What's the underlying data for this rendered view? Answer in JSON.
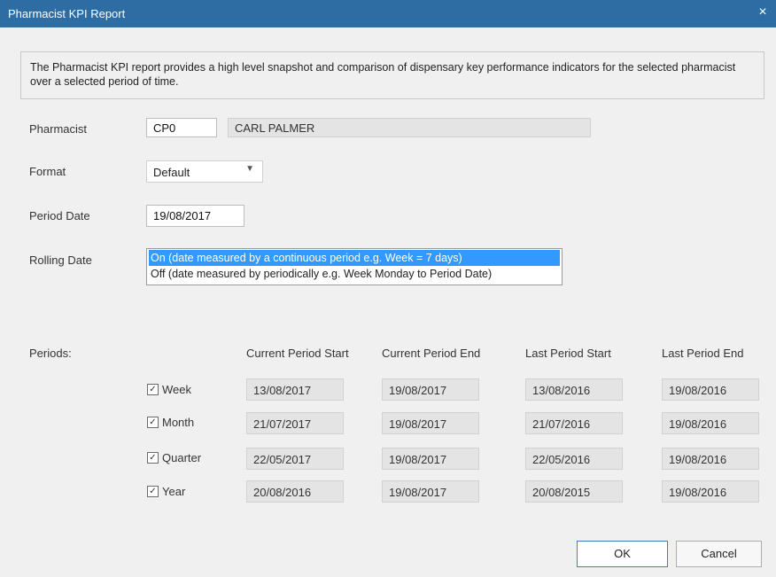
{
  "window": {
    "title": "Pharmacist KPI Report",
    "close_glyph": "×"
  },
  "description": "The Pharmacist KPI report provides a high level snapshot and comparison of dispensary key performance indicators for the selected pharmacist over a selected period of time.",
  "pharmacist": {
    "label": "Pharmacist",
    "code": "CP0",
    "name": "CARL PALMER"
  },
  "format": {
    "label": "Format",
    "value": "Default"
  },
  "period_date": {
    "label": "Period Date",
    "value": "19/08/2017"
  },
  "rolling_date": {
    "label": "Rolling Date",
    "options": [
      "On (date measured by a continuous period e.g. Week = 7 days)",
      "Off (date measured by periodically e.g. Week Monday to Period Date)"
    ],
    "selected_index": 0
  },
  "periods": {
    "label": "Periods:",
    "columns": [
      "Current Period Start",
      "Current Period End",
      "Last Period Start",
      "Last Period End"
    ],
    "rows": [
      {
        "name": "Week",
        "checked": true,
        "values": [
          "13/08/2017",
          "19/08/2017",
          "13/08/2016",
          "19/08/2016"
        ]
      },
      {
        "name": "Month",
        "checked": true,
        "values": [
          "21/07/2017",
          "19/08/2017",
          "21/07/2016",
          "19/08/2016"
        ]
      },
      {
        "name": "Quarter",
        "checked": true,
        "values": [
          "22/05/2017",
          "19/08/2017",
          "22/05/2016",
          "19/08/2016"
        ]
      },
      {
        "name": "Year",
        "checked": true,
        "values": [
          "20/08/2016",
          "19/08/2017",
          "20/08/2015",
          "19/08/2016"
        ]
      }
    ]
  },
  "buttons": {
    "ok": "OK",
    "cancel": "Cancel"
  },
  "colors": {
    "titlebar": "#2e6da4",
    "selection": "#3399ff",
    "background": "#f0f0f0"
  }
}
